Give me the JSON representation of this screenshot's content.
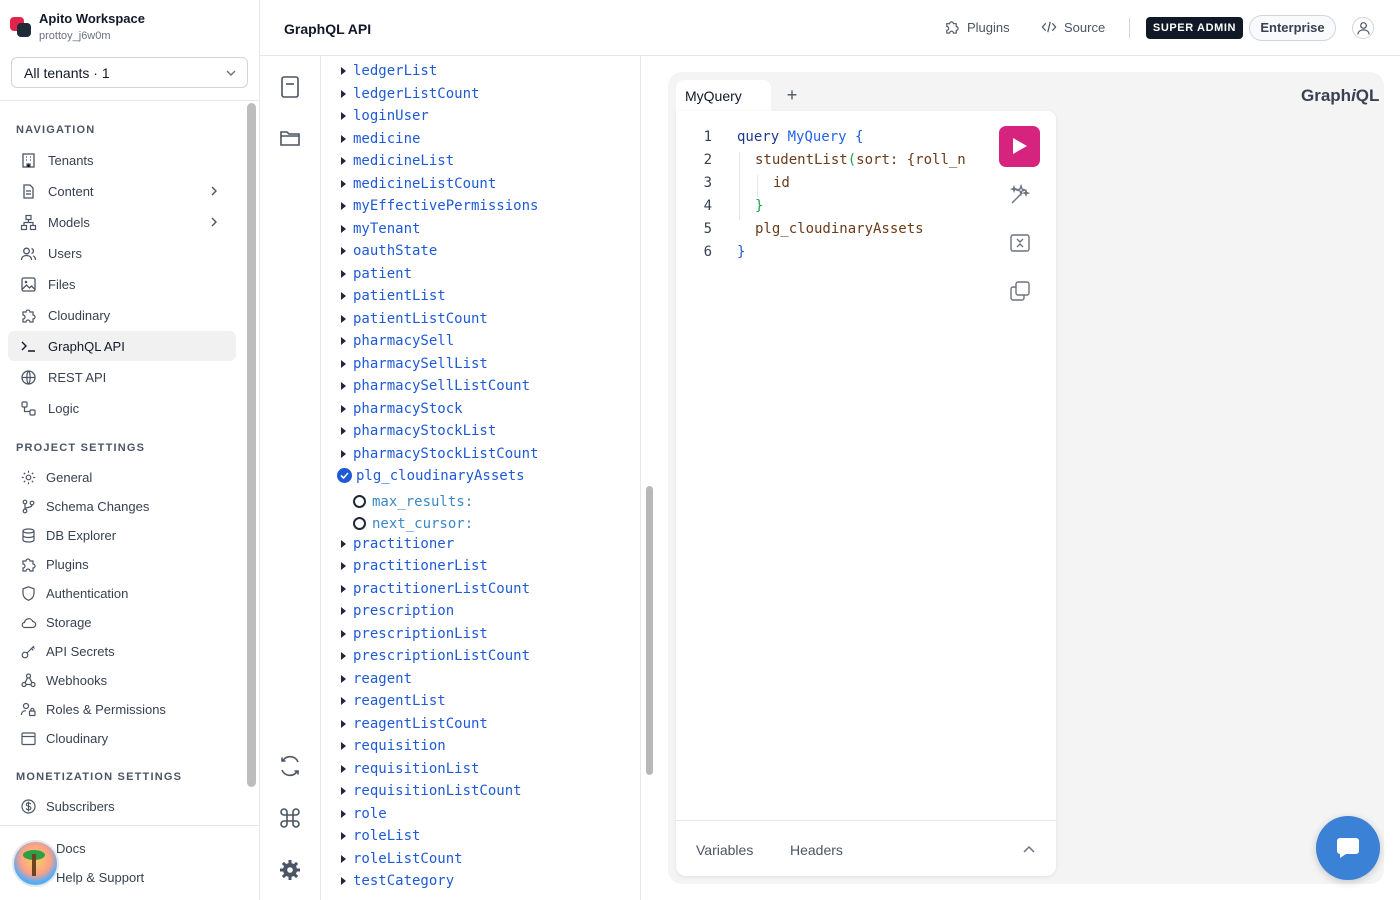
{
  "workspace": {
    "name": "Apito Workspace",
    "subtitle": "prottoy_j6w0m",
    "tenant_select": "All tenants · 1"
  },
  "sidebar": {
    "nav_title": "NAVIGATION",
    "nav_items": [
      {
        "label": "Tenants",
        "icon": "building-icon"
      },
      {
        "label": "Content",
        "icon": "document-icon"
      },
      {
        "label": "Models",
        "icon": "hierarchy-icon"
      },
      {
        "label": "Users",
        "icon": "users-icon"
      },
      {
        "label": "Files",
        "icon": "image-icon"
      },
      {
        "label": "Cloudinary",
        "icon": "puzzle-icon"
      },
      {
        "label": "GraphQL API",
        "icon": "terminal-icon"
      },
      {
        "label": "REST API",
        "icon": "globe-icon"
      },
      {
        "label": "Logic",
        "icon": "logic-icon"
      }
    ],
    "project_title": "PROJECT SETTINGS",
    "project_items": [
      {
        "label": "General",
        "icon": "gear-icon"
      },
      {
        "label": "Schema Changes",
        "icon": "branch-icon"
      },
      {
        "label": "DB Explorer",
        "icon": "database-icon"
      },
      {
        "label": "Plugins",
        "icon": "puzzle-icon"
      },
      {
        "label": "Authentication",
        "icon": "shield-icon"
      },
      {
        "label": "Storage",
        "icon": "cloud-icon"
      },
      {
        "label": "API Secrets",
        "icon": "key-icon"
      },
      {
        "label": "Webhooks",
        "icon": "webhook-icon"
      },
      {
        "label": "Roles & Permissions",
        "icon": "user-lock-icon"
      },
      {
        "label": "Cloudinary",
        "icon": "calendar-icon"
      }
    ],
    "monetization_title": "MONETIZATION SETTINGS",
    "monetization_items": [
      {
        "label": "Subscribers",
        "icon": "dollar-icon"
      }
    ],
    "footer": {
      "docs": "Docs",
      "support": "Help & Support"
    }
  },
  "header": {
    "title": "GraphQL API",
    "plugins": "Plugins",
    "source": "Source",
    "role_badge": "SUPER ADMIN",
    "plan_badge": "Enterprise"
  },
  "explorer": {
    "fields": [
      "ledgerList",
      "ledgerListCount",
      "loginUser",
      "medicine",
      "medicineList",
      "medicineListCount",
      "myEffectivePermissions",
      "myTenant",
      "oauthState",
      "patient",
      "patientList",
      "patientListCount",
      "pharmacySell",
      "pharmacySellList",
      "pharmacySellListCount",
      "pharmacyStock",
      "pharmacyStockList",
      "pharmacyStockListCount"
    ],
    "selected_field": "plg_cloudinaryAssets",
    "selected_args": [
      "max_results:",
      "next_cursor:"
    ],
    "fields_after": [
      "practitioner",
      "practitionerList",
      "practitionerListCount",
      "prescription",
      "prescriptionList",
      "prescriptionListCount",
      "reagent",
      "reagentList",
      "reagentListCount",
      "requisition",
      "requisitionList",
      "requisitionListCount",
      "role",
      "roleList",
      "roleListCount",
      "testCategory"
    ]
  },
  "graphiql": {
    "tab": "MyQuery",
    "add_tab": "+",
    "brand": "GraphiQL",
    "lines": [
      {
        "num": "1",
        "t1": "query",
        "t2": " MyQuery",
        "t3": " {"
      },
      {
        "num": "2",
        "t1": "studentList",
        "t2": "(",
        "t3": "sort: {roll_n"
      },
      {
        "num": "3",
        "t1": "id"
      },
      {
        "num": "4",
        "t1": "}"
      },
      {
        "num": "5",
        "t1": "plg_cloudinaryAssets"
      },
      {
        "num": "6",
        "t1": "}"
      }
    ],
    "bottom_tabs": {
      "variables": "Variables",
      "headers": "Headers"
    }
  },
  "colors": {
    "accent": "#d6247e",
    "link": "#1f5ad6",
    "chat": "#3b82d6"
  }
}
